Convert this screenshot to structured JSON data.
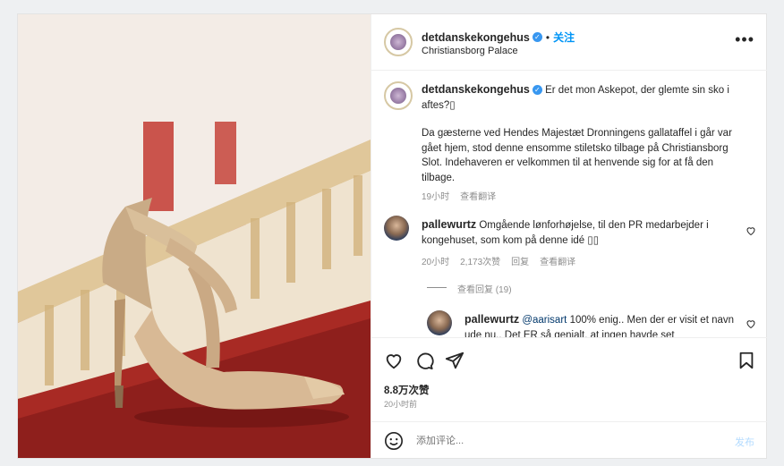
{
  "header": {
    "username": "detdanskekongehus",
    "follow_label": "关注",
    "location": "Christiansborg Palace"
  },
  "caption": {
    "username": "detdanskekongehus",
    "first_line": "Er det mon Askepot, der glemte sin sko i aftes?",
    "emoji_box": "▯",
    "body": "Da gæsterne ved Hendes Majestæt Dronningens gallataffel i går var gået hjem, stod denne ensomme stiletsko tilbage på Christiansborg Slot. Indehaveren er velkommen til at henvende sig for at få den tilbage.",
    "time": "19小时",
    "translate": "查看翻译"
  },
  "comments": [
    {
      "username": "pallewurtz",
      "text": "Omgående lønforhøjelse, til den PR medarbejder i kongehuset, som kom på denne idé ▯▯",
      "time": "20小时",
      "likes": "2,173次赞",
      "reply": "回复",
      "translate": "查看翻译"
    }
  ],
  "view_replies": "查看回复 (19)",
  "reply": {
    "username": "pallewurtz",
    "mention": "@aarisart",
    "text": "100% enig.. Men der er visit et navn ude nu.. Det ER så genialt, at ingen havde set"
  },
  "stats": {
    "likes": "8.8万次赞",
    "time": "20小时前"
  },
  "comment_bar": {
    "placeholder": "添加评论...",
    "post_label": "发布"
  },
  "icons": [
    "heart-icon",
    "comment-icon",
    "share-icon",
    "bookmark-icon",
    "more-icon",
    "emoji-icon",
    "verified-icon"
  ],
  "colors": {
    "accent": "#0095f6",
    "verified": "#3897f0",
    "carpet": "#8e1f1c"
  }
}
